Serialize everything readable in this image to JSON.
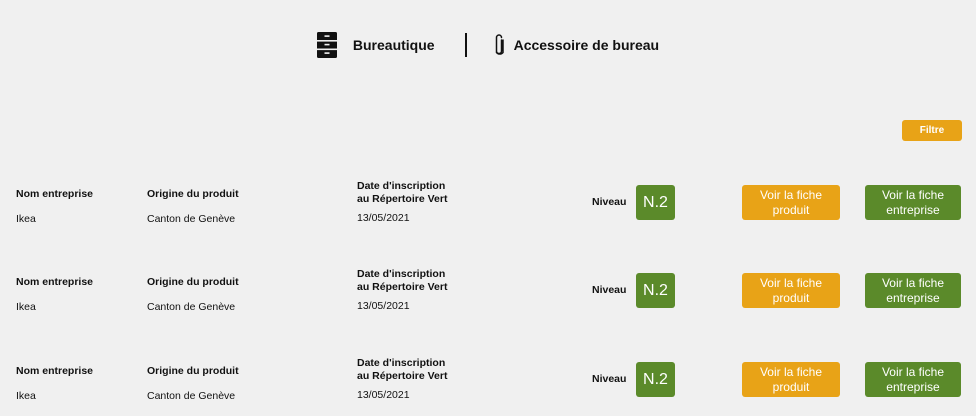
{
  "header": {
    "category": {
      "label": "Bureautique",
      "icon": "filing-cabinet-icon"
    },
    "subcategory": {
      "label": "Accessoire de bureau",
      "icon": "paperclip-icon"
    }
  },
  "filter_label": "Filtre",
  "colors": {
    "accent_orange": "#e8a317",
    "accent_green": "#5b8a2a",
    "background": "#f0f0f0"
  },
  "rows": [
    {
      "company_label": "Nom entreprise",
      "company": "Ikea",
      "origin_label": "Origine du produit",
      "origin": "Canton de Genève",
      "date_label_1": "Date d'inscription",
      "date_label_2": "au Répertoire Vert",
      "date": "13/05/2021",
      "level_label": "Niveau",
      "level": "N.2",
      "product_button_1": "Voir la fiche",
      "product_button_2": "produit",
      "company_button_1": "Voir la fiche",
      "company_button_2": "entreprise"
    },
    {
      "company_label": "Nom entreprise",
      "company": "Ikea",
      "origin_label": "Origine du produit",
      "origin": "Canton de Genève",
      "date_label_1": "Date d'inscription",
      "date_label_2": "au Répertoire Vert",
      "date": "13/05/2021",
      "level_label": "Niveau",
      "level": "N.2",
      "product_button_1": "Voir la fiche",
      "product_button_2": "produit",
      "company_button_1": "Voir la fiche",
      "company_button_2": "entreprise"
    },
    {
      "company_label": "Nom entreprise",
      "company": "Ikea",
      "origin_label": "Origine du produit",
      "origin": "Canton de Genève",
      "date_label_1": "Date d'inscription",
      "date_label_2": "au Répertoire Vert",
      "date": "13/05/2021",
      "level_label": "Niveau",
      "level": "N.2",
      "product_button_1": "Voir la fiche",
      "product_button_2": "produit",
      "company_button_1": "Voir la fiche",
      "company_button_2": "entreprise"
    }
  ]
}
